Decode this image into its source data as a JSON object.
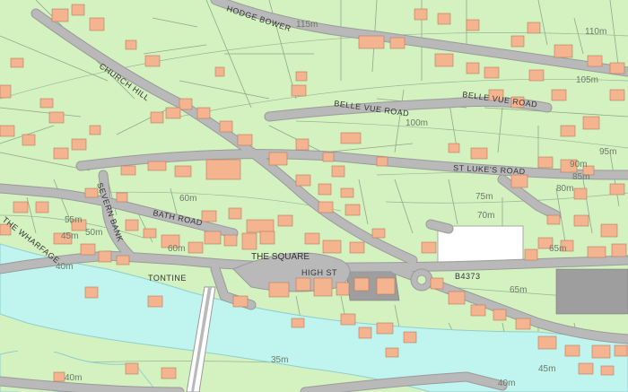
{
  "colors": {
    "land": "#d3f2c0",
    "road": "#b9b9b9",
    "road_edge": "#9a9a9a",
    "building": "#f3b48f",
    "building_edge": "#b97a5a",
    "river": "#bff5ee",
    "river_edge": "#8fcfcf",
    "white_lot": "#ffffff",
    "grey_lot": "#9e9e9e",
    "field_line": "#8fa888"
  },
  "roads": {
    "hodge_bower": "HODGE BOWER",
    "church_hill": "CHURCH HILL",
    "belle_vue_road_west": "BELLE VUE ROAD",
    "belle_vue_road_east": "BELLE VUE ROAD",
    "st_lukes_road": "ST LUKE'S ROAD",
    "severn_bank": "SEVERN BANK",
    "bath_road": "BATH ROAD",
    "the_wharfage": "THE WHARFAGE",
    "high_st": "HIGH ST",
    "tontine": "TONTINE",
    "b4373": "B4373"
  },
  "places": {
    "the_square": "THE SQUARE"
  },
  "contours": {
    "c115": "115m",
    "c110": "110m",
    "c105": "105m",
    "c100": "100m",
    "c95": "95m",
    "c90": "90m",
    "c85": "85m",
    "c80": "80m",
    "c75": "75m",
    "c70": "70m",
    "c65a": "65m",
    "c65b": "65m",
    "c60a": "60m",
    "c60b": "60m",
    "c55": "55m",
    "c50": "50m",
    "c45a": "45m",
    "c45b": "45m",
    "c40a": "40m",
    "c40b": "40m",
    "c40c": "40m",
    "c35": "35m"
  }
}
